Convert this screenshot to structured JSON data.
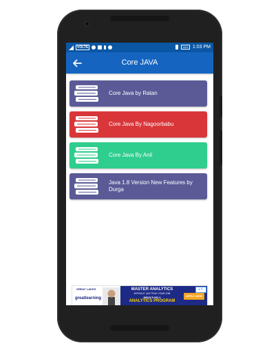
{
  "status_bar": {
    "network_badge": "VOLTE",
    "battery_percent": "48%",
    "time": "1:03 PM"
  },
  "toolbar": {
    "title": "Core JAVA",
    "back_icon": "arrow-left-icon"
  },
  "courses": [
    {
      "label": "Core Java by Ratan",
      "color": "#5b5a97"
    },
    {
      "label": "Core Java By Nagoorbabu",
      "color": "#d9363a"
    },
    {
      "label": "Core Java By Anil",
      "color": "#2fcd8e"
    },
    {
      "label": "Java 1.8  Version New Features by Durga",
      "color": "#5b5a97"
    }
  ],
  "ad": {
    "logo_top": "GREAT LAKES",
    "logo": "greatlearning",
    "headline": "MASTER ANALYTICS",
    "subline": "WITHOUT QUITTING YOUR JOB",
    "tagline": "INDIA'S NO.1",
    "program": "ANALYTICS PROGRAM",
    "cta": "APPLY NOW",
    "choices_icon": "ad-choices-icon"
  },
  "colors": {
    "status_bar": "#0b57a4",
    "toolbar": "#1565c0"
  }
}
